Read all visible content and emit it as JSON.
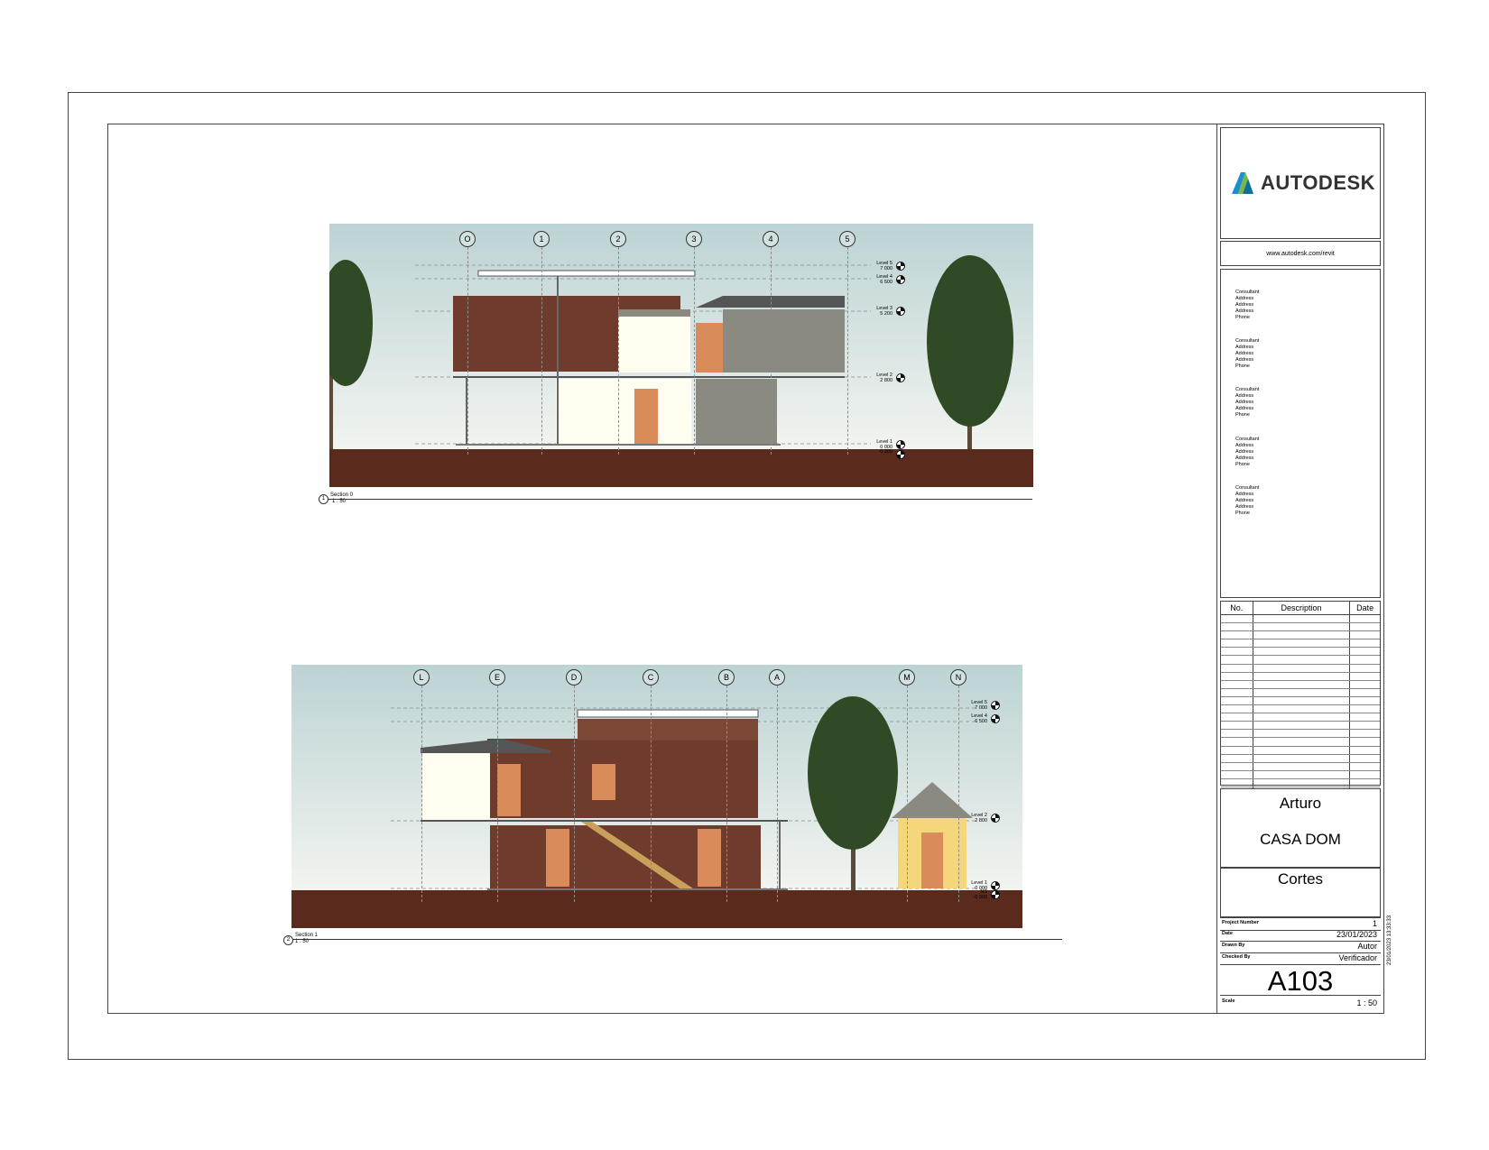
{
  "titleblock": {
    "logo": "AUTODESK",
    "url": "www.autodesk.com/revit",
    "consultants": [
      {
        "name": "Consultant",
        "lines": [
          "Address",
          "Address",
          "Address",
          "Phone"
        ]
      },
      {
        "name": "Consultant",
        "lines": [
          "Address",
          "Address",
          "Address",
          "Phone"
        ]
      },
      {
        "name": "Consultant",
        "lines": [
          "Address",
          "Address",
          "Address",
          "Phone"
        ]
      },
      {
        "name": "Consultant",
        "lines": [
          "Address",
          "Address",
          "Address",
          "Phone"
        ]
      },
      {
        "name": "Consultant",
        "lines": [
          "Address",
          "Address",
          "Address",
          "Phone"
        ]
      }
    ],
    "revisions_header": {
      "no": "No.",
      "description": "Description",
      "date": "Date"
    },
    "client": "Arturo",
    "project_name": "CASA DOM",
    "sheet_name": "Cortes",
    "project_number_label": "Project Number",
    "project_number": "1",
    "date_label": "Date",
    "date": "23/01/2023",
    "drawn_by_label": "Drawn By",
    "drawn_by": "Autor",
    "checked_by_label": "Checked By",
    "checked_by": "Verificador",
    "sheet_number": "A103",
    "scale_label": "Scale",
    "scale": "1 : 50",
    "print_stamp": "23/01/2023 13:33:33"
  },
  "views": {
    "section0": {
      "number": "1",
      "title": "Section 0",
      "scale": "1 : 50",
      "grids": [
        "O",
        "1",
        "2",
        "3",
        "4",
        "5"
      ],
      "levels": [
        {
          "name": "Level 5",
          "elev": "7 000"
        },
        {
          "name": "Level 4",
          "elev": "6 500"
        },
        {
          "name": "Level 3",
          "elev": "5 200"
        },
        {
          "name": "Level 2",
          "elev": "2 800"
        },
        {
          "name": "Level 1",
          "elev": "0 000"
        },
        {
          "name": "",
          "elev": "-0 300"
        }
      ]
    },
    "section1": {
      "number": "2",
      "title": "Section 1",
      "scale": "1 : 50",
      "grids": [
        "L",
        "E",
        "D",
        "C",
        "B",
        "A",
        "M",
        "N"
      ],
      "levels": [
        {
          "name": "Level 5",
          "elev": "7 000"
        },
        {
          "name": "Level 4",
          "elev": "6 500"
        },
        {
          "name": "Level 2",
          "elev": "2 800"
        },
        {
          "name": "Level 1",
          "elev": "0 000"
        },
        {
          "name": "NS",
          "elev": "-0 300"
        }
      ]
    }
  },
  "colors": {
    "sky_top": "#bcd3d4",
    "sky_bottom": "#f2f4f0",
    "ground": "#5a2a1c",
    "brick": "#6e3b2c",
    "door": "#d98b5a",
    "tree": "#2f4a24",
    "panel": "#8b8a80"
  }
}
